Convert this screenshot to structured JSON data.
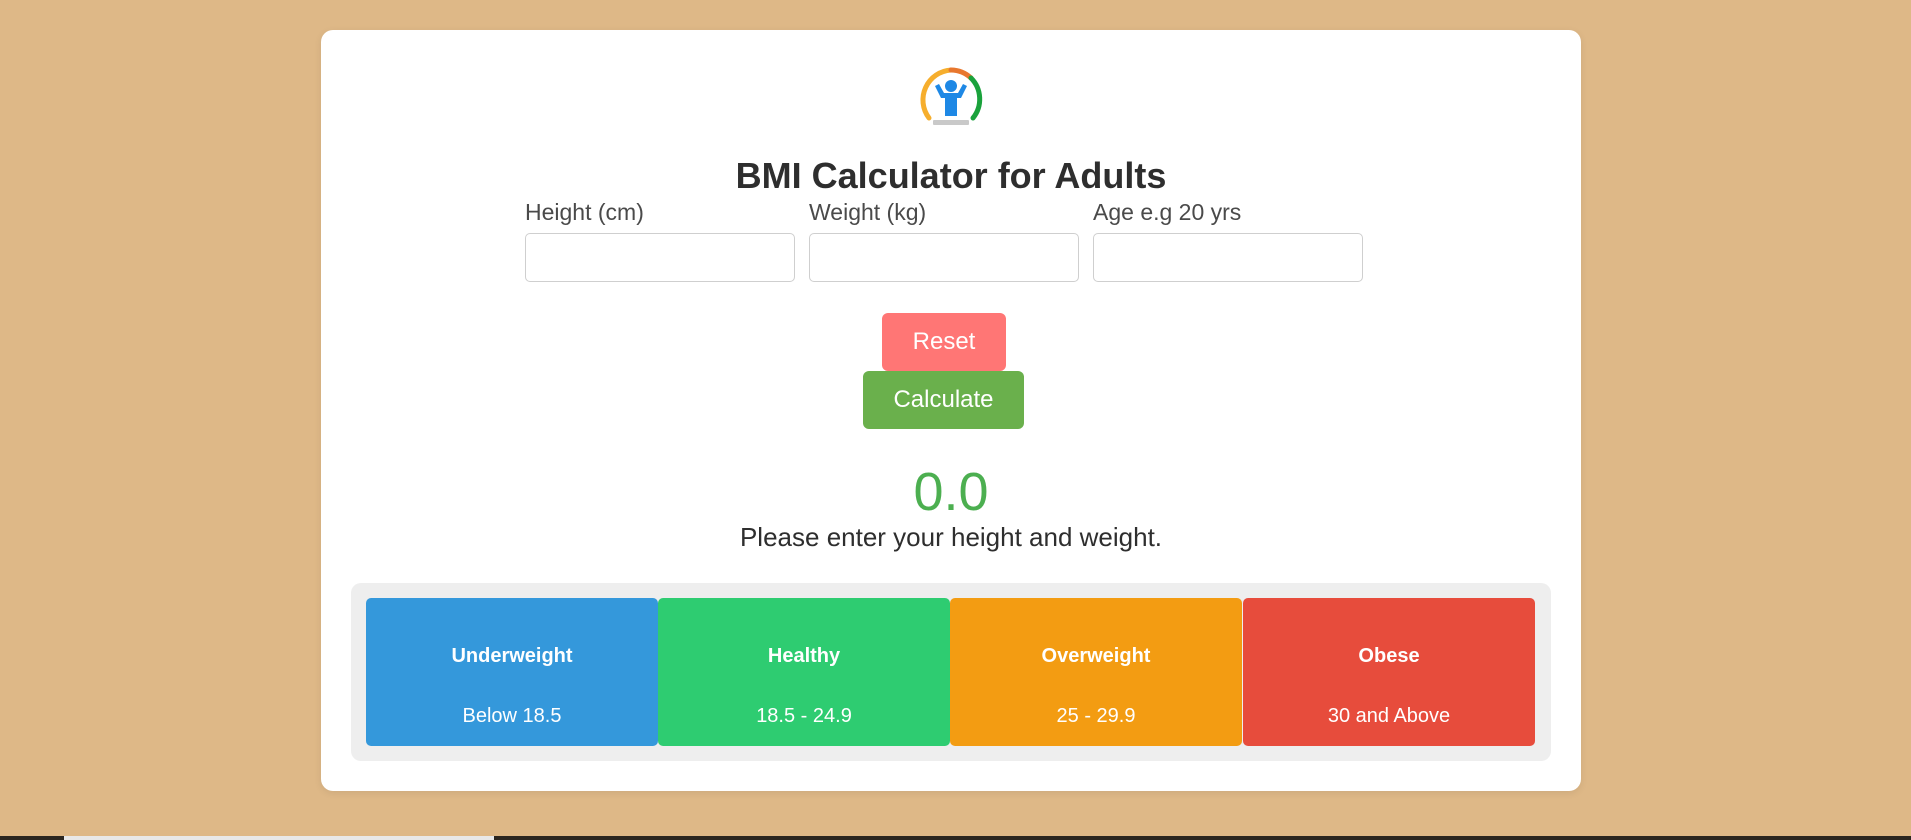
{
  "app": {
    "title": "BMI Calculator for Adults",
    "logo_icon": "bmi-fitness-gauge-icon"
  },
  "form": {
    "height_label": "Height (cm)",
    "weight_label": "Weight (kg)",
    "age_label": "Age e.g 20 yrs",
    "height_value": "",
    "weight_value": "",
    "age_value": ""
  },
  "buttons": {
    "reset_label": "Reset",
    "calculate_label": "Calculate"
  },
  "result": {
    "bmi_value": "0.0",
    "message": "Please enter your height and weight."
  },
  "categories": [
    {
      "name": "Underweight",
      "range": "Below 18.5",
      "color": "#3498db"
    },
    {
      "name": "Healthy",
      "range": "18.5 - 24.9",
      "color": "#2ecc71"
    },
    {
      "name": "Overweight",
      "range": "25 - 29.9",
      "color": "#f39c12"
    },
    {
      "name": "Obese",
      "range": "30 and Above",
      "color": "#e74c3c"
    }
  ],
  "colors": {
    "background": "#deb887",
    "card": "#ffffff",
    "reset_button": "#ff7675",
    "calculate_button": "#6ab04c",
    "bmi_value": "#4caf50"
  }
}
